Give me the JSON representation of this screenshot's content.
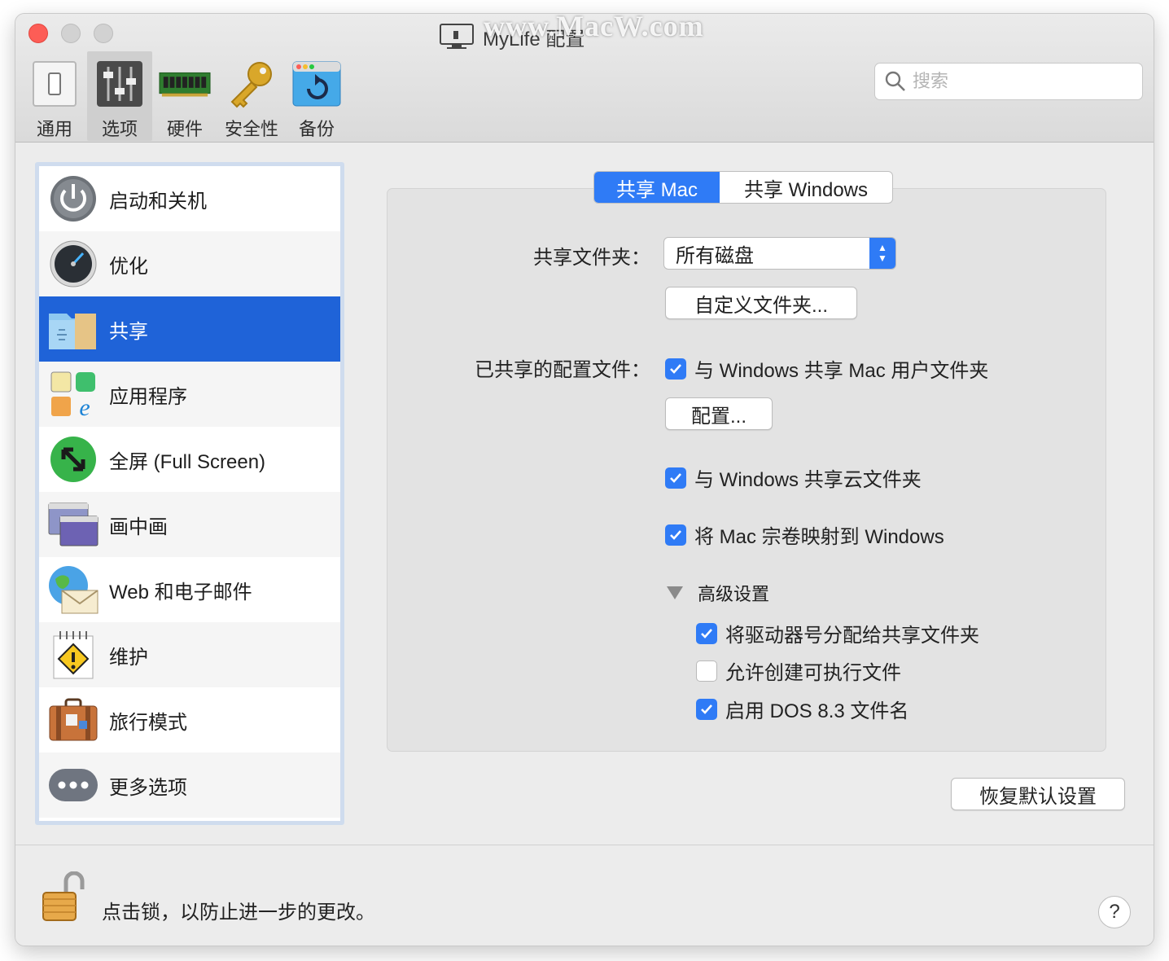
{
  "window": {
    "title": "MyLife 配置",
    "watermark": "www.MacW.com"
  },
  "toolbar": {
    "items": [
      {
        "label": "通用",
        "icon": "switch-icon"
      },
      {
        "label": "选项",
        "icon": "sliders-icon",
        "active": true
      },
      {
        "label": "硬件",
        "icon": "memory-chip-icon"
      },
      {
        "label": "安全性",
        "icon": "key-icon"
      },
      {
        "label": "备份",
        "icon": "backup-icon"
      }
    ]
  },
  "search": {
    "placeholder": "搜索"
  },
  "sidebar": {
    "items": [
      {
        "label": "启动和关机",
        "icon": "power-icon"
      },
      {
        "label": "优化",
        "icon": "speedometer-icon"
      },
      {
        "label": "共享",
        "icon": "shared-folder-icon",
        "selected": true
      },
      {
        "label": "应用程序",
        "icon": "applications-icon"
      },
      {
        "label": "全屏 (Full Screen)",
        "icon": "fullscreen-icon"
      },
      {
        "label": "画中画",
        "icon": "picture-in-picture-icon"
      },
      {
        "label": "Web 和电子邮件",
        "icon": "globe-mail-icon"
      },
      {
        "label": "维护",
        "icon": "maintenance-warning-icon"
      },
      {
        "label": "旅行模式",
        "icon": "suitcase-icon"
      },
      {
        "label": "更多选项",
        "icon": "more-options-icon"
      }
    ]
  },
  "tabs": {
    "mac": "共享 Mac",
    "windows": "共享 Windows"
  },
  "sharing": {
    "shared_folders_label": "共享文件夹：",
    "shared_folders_value": "所有磁盘",
    "custom_folders_button": "自定义文件夹...",
    "shared_profile_label": "已共享的配置文件：",
    "share_user_folders": {
      "label": "与 Windows 共享 Mac 用户文件夹",
      "checked": true
    },
    "configure_button": "配置...",
    "share_cloud_folders": {
      "label": "与 Windows 共享云文件夹",
      "checked": true
    },
    "map_volumes": {
      "label": "将 Mac 宗卷映射到 Windows",
      "checked": true
    },
    "advanced_label": "高级设置",
    "assign_drive_letters": {
      "label": "将驱动器号分配给共享文件夹",
      "checked": true
    },
    "allow_executables": {
      "label": "允许创建可执行文件",
      "checked": false
    },
    "enable_dos_names": {
      "label": "启用 DOS 8.3 文件名",
      "checked": true
    }
  },
  "restore_defaults_button": "恢复默认设置",
  "footer": {
    "lock_text": "点击锁，以防止进一步的更改。",
    "help": "?"
  },
  "colors": {
    "accent": "#2f7bf6",
    "selection": "#1f63d8"
  }
}
